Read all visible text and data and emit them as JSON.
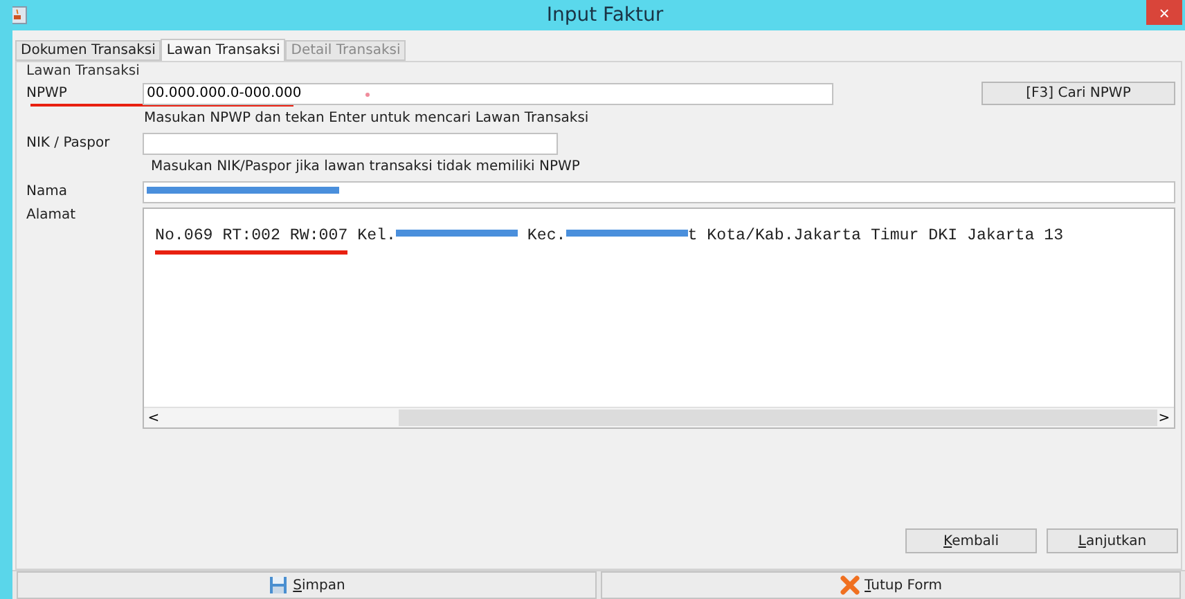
{
  "window": {
    "title": "Input Faktur",
    "close": "×"
  },
  "tabs": [
    {
      "label": "Dokumen Transaksi",
      "selected": false,
      "disabled": false
    },
    {
      "label": "Lawan Transaksi",
      "selected": true,
      "disabled": false
    },
    {
      "label": "Detail Transaksi",
      "selected": false,
      "disabled": true
    }
  ],
  "group": {
    "title": "Lawan Transaksi"
  },
  "npwp": {
    "label": "NPWP",
    "value": "00.000.000.0-000.000",
    "underlined": true,
    "hint": "Masukan NPWP dan tekan Enter untuk mencari Lawan Transaksi",
    "button": "[F3] Cari NPWP"
  },
  "nik": {
    "label": "NIK / Paspor",
    "hint": "Masukan NIK/Paspor jika lawan transaksi tidak memiliki NPWP"
  },
  "nama": {
    "label": "Nama",
    "redacted": true
  },
  "alamat": {
    "label": "Alamat",
    "parts": [
      {
        "kind": "text",
        "text": "No.069 RT:002 RW:007",
        "underlined": true
      },
      {
        "kind": "text",
        "text": " Kel.",
        "underlined": false
      },
      {
        "kind": "redacted"
      },
      {
        "kind": "text",
        "text": " Kec.",
        "underlined": false
      },
      {
        "kind": "redacted"
      },
      {
        "kind": "text",
        "text": "t Kota/Kab.Jakarta Timur DKI Jakarta 13",
        "underlined": false
      }
    ],
    "scroll_left": "<",
    "scroll_right": ">"
  },
  "nav_buttons": [
    {
      "label": "Kembali",
      "mnemonic_first": true
    },
    {
      "label": "Lanjutkan",
      "mnemonic_first": true
    }
  ],
  "bottom_buttons": [
    {
      "label": "Simpan",
      "kind": "save",
      "mnemonic_first": true
    },
    {
      "label": "Tutup Form",
      "kind": "close",
      "mnemonic_first": true
    }
  ]
}
